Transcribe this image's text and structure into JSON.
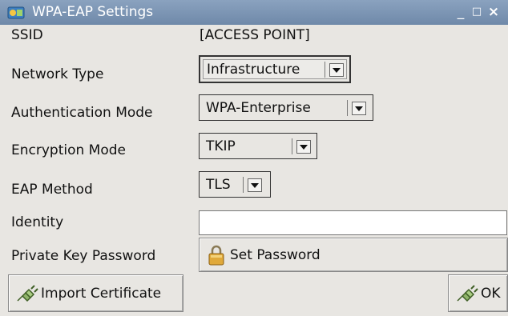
{
  "window": {
    "title": "WPA-EAP Settings",
    "minimize_glyph": "_",
    "maximize_glyph": "□",
    "close_glyph": "×"
  },
  "fields": {
    "ssid_label": "SSID",
    "ssid_value": "[ACCESS POINT]",
    "network_type_label": "Network Type",
    "network_type_value": "Infrastructure",
    "auth_mode_label": "Authentication Mode",
    "auth_mode_value": "WPA-Enterprise",
    "encryption_label": "Encryption Mode",
    "encryption_value": "TKIP",
    "eap_label": "EAP Method",
    "eap_value": "TLS",
    "identity_label": "Identity",
    "identity_value": "",
    "private_key_label": "Private Key Password",
    "set_password_label": "Set Password"
  },
  "buttons": {
    "import_certificate_label": "Import Certificate",
    "ok_label": "OK"
  },
  "icons": {
    "app": "network-settings-icon",
    "lock": "lock-icon",
    "plug": "plug-icon"
  },
  "colors": {
    "titlebar": "#7b93b2",
    "background": "#e8e6e2",
    "input_background": "#ffffff"
  }
}
